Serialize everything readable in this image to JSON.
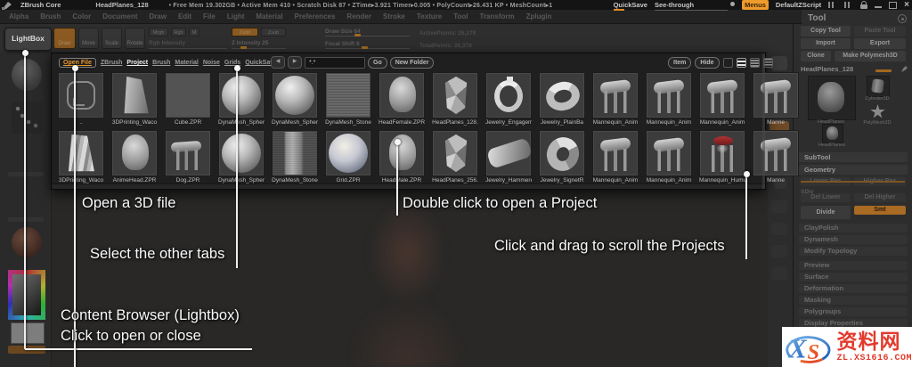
{
  "titlebar": {
    "app": "ZBrush Core",
    "doc": "HeadPlanes_128",
    "stats": "• Free Mem 19.302GB  • Active Mem 410  • Scratch Disk 87  •  ZTime▸3.921  Timer▸0.005  • PolyCount▸26.431 KP  • MeshCount▸1",
    "quicksave": "QuickSave",
    "see_through": "See-through",
    "menus": "Menus",
    "default_zscript": "DefaultZScript",
    "close": "×"
  },
  "menubar": {
    "items": [
      "Alpha",
      "Brush",
      "Color",
      "Document",
      "Draw",
      "Edit",
      "File",
      "Light",
      "Material",
      "Preferences",
      "Render",
      "Stroke",
      "Texture",
      "Tool",
      "Transform",
      "Zplugin"
    ]
  },
  "shelf": {
    "lightbox": "LightBox",
    "draw": "Draw",
    "move": "Move",
    "scale": "Scale",
    "rotate": "Rotate",
    "mrgb": "Mrgb",
    "rgb": "Rgb",
    "m": "M",
    "rgb_intensity": "Rgb Intensity",
    "zadd": "Zadd",
    "zsub": "Zsub",
    "z_intensity": "Z Intensity 25",
    "draw_size": "Draw Size 64",
    "focal_shift": "Focal Shift 8",
    "active_points": "ActivePoints: 26,279",
    "total_points": "TotalPoints: 26,378"
  },
  "lightbox": {
    "tabs": [
      {
        "label": "Open File",
        "state": "active-orange"
      },
      {
        "label": "ZBrush",
        "state": ""
      },
      {
        "label": "Project",
        "state": "active-white"
      },
      {
        "label": "Brush",
        "state": ""
      },
      {
        "label": "Material",
        "state": ""
      },
      {
        "label": "Noise",
        "state": ""
      },
      {
        "label": "Grids",
        "state": ""
      },
      {
        "label": "QuickSave",
        "state": ""
      }
    ],
    "arrow_left": "◀",
    "arrow_right": "▶",
    "path_value": "*.*",
    "go": "Go",
    "new_folder": "New Folder",
    "item": "Item",
    "hide": "Hide",
    "rows": [
      [
        {
          "label": "..",
          "type": "folder"
        },
        {
          "label": "3DPrinting_Waco",
          "type": "vase"
        },
        {
          "label": "Cube.ZPR",
          "type": "cube"
        },
        {
          "label": "DynaMesh_Spher",
          "type": "sphere"
        },
        {
          "label": "DynaMesh_Spher",
          "type": "sphere"
        },
        {
          "label": "DynaMesh_Stone",
          "type": "noise"
        },
        {
          "label": "HeadFemale.ZPR",
          "type": "head"
        },
        {
          "label": "HeadPlanes_128.",
          "type": "headplanes"
        },
        {
          "label": "Jewelry_Engagem",
          "type": "ring"
        },
        {
          "label": "Jewelry_PlainBa",
          "type": "band"
        },
        {
          "label": "Mannequin_Anim",
          "type": "mannequin"
        },
        {
          "label": "Mannequin_Anim",
          "type": "mannequin"
        },
        {
          "label": "Mannequin_Anim",
          "type": "mannequin"
        },
        {
          "label": "Manne",
          "type": "mannequin"
        }
      ],
      [
        {
          "label": "3DPrinting_Waco",
          "type": "vstripe"
        },
        {
          "label": "AnimeHead.ZPR",
          "type": "head"
        },
        {
          "label": "Dog.ZPR",
          "type": "dog"
        },
        {
          "label": "DynaMesh_Spher",
          "type": "sphere"
        },
        {
          "label": "DynaMesh_Stone",
          "type": "stonecol"
        },
        {
          "label": "Grid.ZPR",
          "type": "sphereblue"
        },
        {
          "label": "HeadMale.ZPR",
          "type": "head"
        },
        {
          "label": "HeadPlanes_256.",
          "type": "headplanes"
        },
        {
          "label": "Jewelry_Hammere",
          "type": "cylband"
        },
        {
          "label": "Jewelry_SignetR",
          "type": "signet"
        },
        {
          "label": "Mannequin_Anim",
          "type": "mannequin"
        },
        {
          "label": "Mannequin_Anim",
          "type": "mannequin"
        },
        {
          "label": "Mannequin_Humu",
          "type": "mannequinred"
        },
        {
          "label": "Manne",
          "type": "mannequin"
        }
      ]
    ]
  },
  "tool_panel": {
    "title": "Tool",
    "back_arrow": "‹",
    "copy": "Copy Tool",
    "paste": "Paste Tool",
    "import": "Import",
    "export": "Export",
    "clone": "Clone",
    "make_polymesh": "Make Polymesh3D",
    "active_tool": "HeadPlanes_128",
    "preview_label": "HeadPlanes",
    "thumb_cylinder": "Cylinder3D",
    "thumb_star": "PolyMesh3D",
    "thumb_head": "HeadPlanes",
    "subtool": "SubTool",
    "geometry": "Geometry",
    "lower_res": "Lower Res",
    "higher_res": "Higher Res",
    "sdiv": "SDiv",
    "del_lower": "Del Lower",
    "del_higher": "Del Higher",
    "divide": "Divide",
    "smt": "Smt",
    "sections": [
      "ClayPolish",
      "Dynamesh",
      "Modify Topology",
      "Preview",
      "Surface",
      "Deformation",
      "Masking",
      "Polygroups",
      "Display Properties"
    ]
  },
  "annotations": {
    "open_file": "Open a 3D file",
    "tabs": "Select the other tabs",
    "double_click": "Double click to open a Project",
    "drag_scroll": "Click and drag to scroll the Projects",
    "lightbox_line1": "Content Browser (Lightbox)",
    "lightbox_line2": "Click to open or close"
  },
  "watermark": {
    "logo": "XS",
    "name": "资料网",
    "url": "ZL.XS1616.COM"
  }
}
